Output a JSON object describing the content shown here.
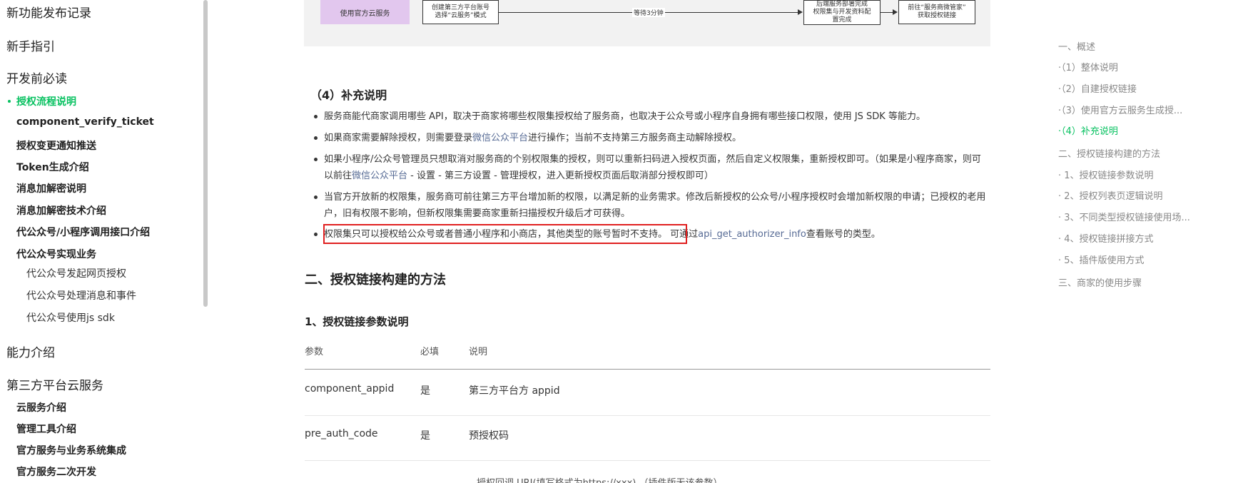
{
  "sidebar": {
    "items": [
      {
        "label": "新功能发布记录",
        "level": 1
      },
      {
        "label": "新手指引",
        "level": 1
      },
      {
        "label": "开发前必读",
        "level": 1
      },
      {
        "label": "授权流程说明",
        "level": 2,
        "active": true
      },
      {
        "label": "component_verify_ticket",
        "level": 2
      },
      {
        "label": "授权变更通知推送",
        "level": 2
      },
      {
        "label": "Token生成介绍",
        "level": 2
      },
      {
        "label": "消息加解密说明",
        "level": 2
      },
      {
        "label": "消息加解密技术介绍",
        "level": 2
      },
      {
        "label": "代公众号/小程序调用接口介绍",
        "level": 2
      },
      {
        "label": "代公众号实现业务",
        "level": 2
      },
      {
        "label": "代公众号发起网页授权",
        "level": 3
      },
      {
        "label": "代公众号处理消息和事件",
        "level": 3
      },
      {
        "label": "代公众号使用js sdk",
        "level": 3
      },
      {
        "label": "能力介绍",
        "level": 1
      },
      {
        "label": "第三方平台云服务",
        "level": 1
      },
      {
        "label": "云服务介绍",
        "level": 2
      },
      {
        "label": "管理工具介绍",
        "level": 2
      },
      {
        "label": "官方服务与业务系统集成",
        "level": 2
      },
      {
        "label": "官方服务二次开发",
        "level": 2
      }
    ]
  },
  "diagram": {
    "purple_label": "使用官方云服务",
    "box1": "创建第三方平台账号\n选择“云服务”模式",
    "wait_label": "等待3分钟",
    "box2": "后端服务部署完成\n权限集与开发资料配\n置完成",
    "box3": "前往“服务商微管家”\n获取授权链接"
  },
  "section4": {
    "heading": "（4）补充说明",
    "bullets": [
      {
        "parts": [
          {
            "text": "服务商能代商家调用哪些 API，取决于商家将哪些权限集授权给了服务商，也取决于公众号或小程序自身拥有哪些接口权限，使用 JS SDK 等能力。"
          }
        ]
      },
      {
        "parts": [
          {
            "text": "如果商家需要解除授权，则需要登录"
          },
          {
            "text": "微信公众平台",
            "link": true
          },
          {
            "text": "进行操作；当前不支持第三方服务商主动解除授权。"
          }
        ]
      },
      {
        "parts": [
          {
            "text": "如果小程序/公众号管理员只想取消对服务商的个别权限集的授权，则可以重新扫码进入授权页面，然后自定义权限集，重新授权即可。（如果是小程序商家，则可以前往"
          },
          {
            "text": "微信公众平台",
            "link": true
          },
          {
            "text": " - 设置 - 第三方设置 - 管理授权，进入更新授权页面后取消部分授权即可）"
          }
        ]
      },
      {
        "parts": [
          {
            "text": "当官方开放新的权限集，服务商可前往第三方平台增加新的权限，以满足新的业务需求。修改后新授权的公众号/小程序授权时会增加新权限的申请；已授权的老用户，旧有权限不影响，但新权限集需要商家重新扫描授权升级后才可获得。"
          }
        ]
      },
      {
        "parts": [
          {
            "text": "权限集只可以授权给公众号或者普通小程序和小商店，其他类型的账号暂时不支持。"
          },
          {
            "text": " 可通过"
          },
          {
            "text": "api_get_authorizer_info",
            "link": true
          },
          {
            "text": "查看账号的类型。"
          }
        ]
      }
    ]
  },
  "section_h2": "二、授权链接构建的方法",
  "section_h4": "1、授权链接参数说明",
  "table": {
    "headers": [
      "参数",
      "必填",
      "说明"
    ],
    "rows": [
      [
        "component_appid",
        "是",
        "第三方平台方 appid"
      ],
      [
        "pre_auth_code",
        "是",
        "预授权码"
      ],
      [
        "",
        "",
        "授权回调 URI(填写格式为https://xxx) （插件版无该参数）"
      ]
    ]
  },
  "toc": {
    "items": [
      {
        "label": "一、概述",
        "indent": 0
      },
      {
        "label": "·（1）整体说明",
        "indent": 1
      },
      {
        "label": "·（2）自建授权链接",
        "indent": 1
      },
      {
        "label": "·（3）使用官方云服务生成授...",
        "indent": 1
      },
      {
        "label": "·（4）补充说明",
        "indent": 1,
        "active": true
      },
      {
        "label": "二、授权链接构建的方法",
        "indent": 0
      },
      {
        "label": "· 1、授权链接参数说明",
        "indent": 1
      },
      {
        "label": "· 2、授权列表页逻辑说明",
        "indent": 1
      },
      {
        "label": "· 3、不同类型授权链接使用场...",
        "indent": 1
      },
      {
        "label": "· 4、授权链接拼接方式",
        "indent": 1
      },
      {
        "label": "· 5、插件版使用方式",
        "indent": 1
      },
      {
        "label": "三、商家的使用步骤",
        "indent": 0
      }
    ]
  },
  "colors": {
    "accent": "#07c160",
    "link": "#576b95",
    "highlight": "#e02020",
    "diagram_purple": "#e2c7ee"
  }
}
